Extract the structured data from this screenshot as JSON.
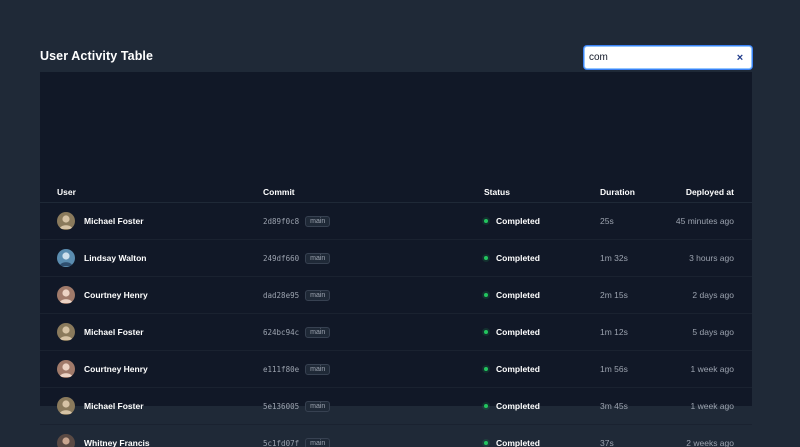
{
  "header": {
    "title": "User Activity Table"
  },
  "search": {
    "value": "com",
    "clear_label": "×"
  },
  "table": {
    "columns": {
      "user": "User",
      "commit": "Commit",
      "status": "Status",
      "duration": "Duration",
      "deployed": "Deployed at"
    },
    "rows": [
      {
        "user": "Michael Foster",
        "avatar": "#8a7a5c",
        "commit": "2d89f0c8",
        "branch": "main",
        "status": "Completed",
        "duration": "25s",
        "deployed": "45 minutes ago"
      },
      {
        "user": "Lindsay Walton",
        "avatar": "#5b8db0",
        "commit": "249df660",
        "branch": "main",
        "status": "Completed",
        "duration": "1m 32s",
        "deployed": "3 hours ago"
      },
      {
        "user": "Courtney Henry",
        "avatar": "#a07a6a",
        "commit": "dad28e95",
        "branch": "main",
        "status": "Completed",
        "duration": "2m 15s",
        "deployed": "2 days ago"
      },
      {
        "user": "Michael Foster",
        "avatar": "#8a7a5c",
        "commit": "624bc94c",
        "branch": "main",
        "status": "Completed",
        "duration": "1m 12s",
        "deployed": "5 days ago"
      },
      {
        "user": "Courtney Henry",
        "avatar": "#a07a6a",
        "commit": "e111f80e",
        "branch": "main",
        "status": "Completed",
        "duration": "1m 56s",
        "deployed": "1 week ago"
      },
      {
        "user": "Michael Foster",
        "avatar": "#8a7a5c",
        "commit": "5e136005",
        "branch": "main",
        "status": "Completed",
        "duration": "3m 45s",
        "deployed": "1 week ago"
      },
      {
        "user": "Whitney Francis",
        "avatar": "#5a4a44",
        "commit": "5c1fd07f",
        "branch": "main",
        "status": "Completed",
        "duration": "37s",
        "deployed": "2 weeks ago"
      }
    ]
  },
  "colors": {
    "page_bg": "#1f2937",
    "card_bg": "#111827",
    "status_green": "#22c55e",
    "focus_ring": "#3b82f6"
  }
}
